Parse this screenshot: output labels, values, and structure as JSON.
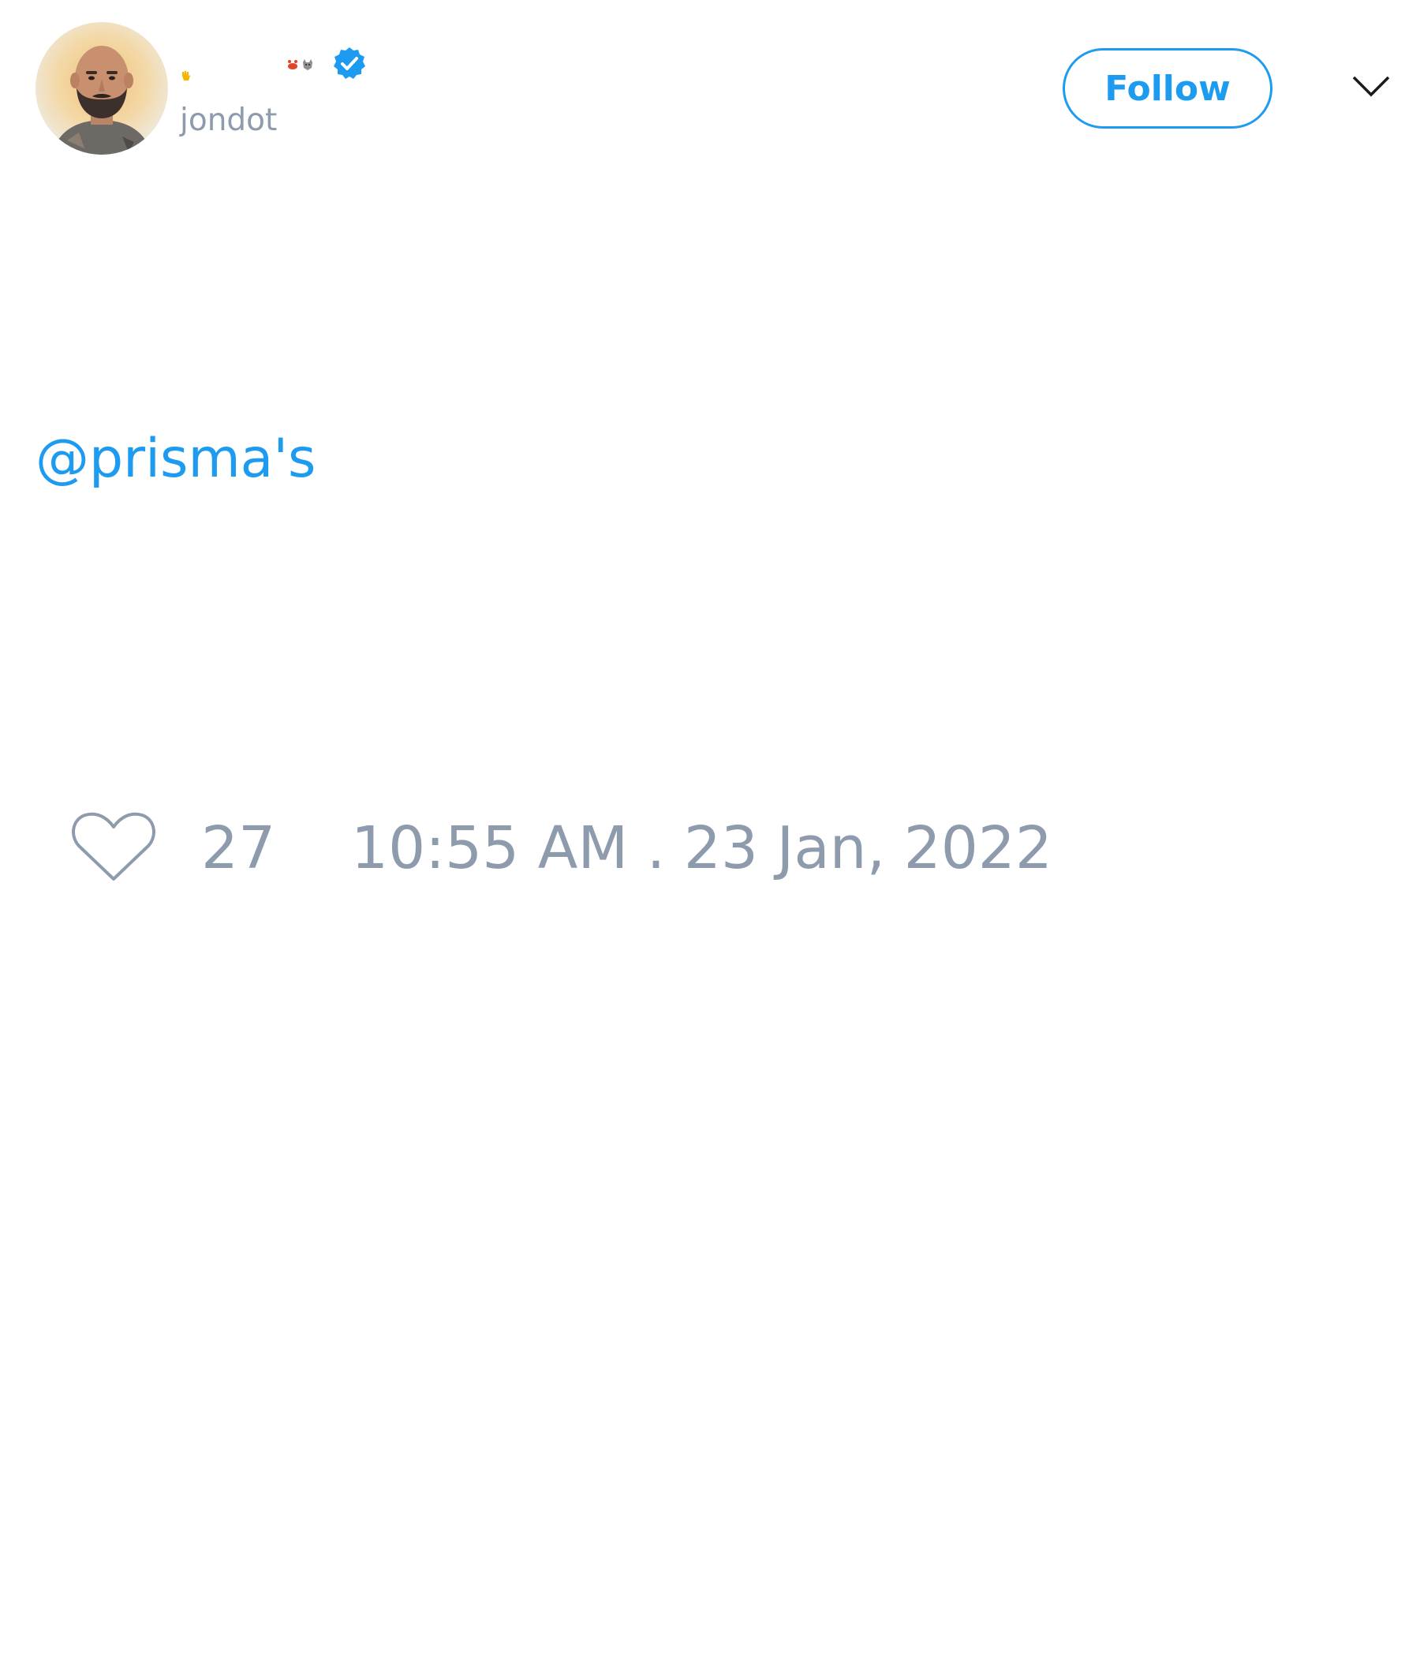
{
  "author": {
    "display_name_emojis": [
      "raised-hand-emoji",
      "crab-emoji",
      "wolf-emoji"
    ],
    "handle": "jondot",
    "verified": true
  },
  "header": {
    "follow_label": "Follow"
  },
  "tweet": {
    "mention": "@prisma's",
    "likes": "27",
    "timestamp": "10:55 AM . 23 Jan, 2022"
  },
  "colors": {
    "accent": "#1d9bf0",
    "muted_text": "#8e9bad",
    "background": "#ffffff"
  }
}
